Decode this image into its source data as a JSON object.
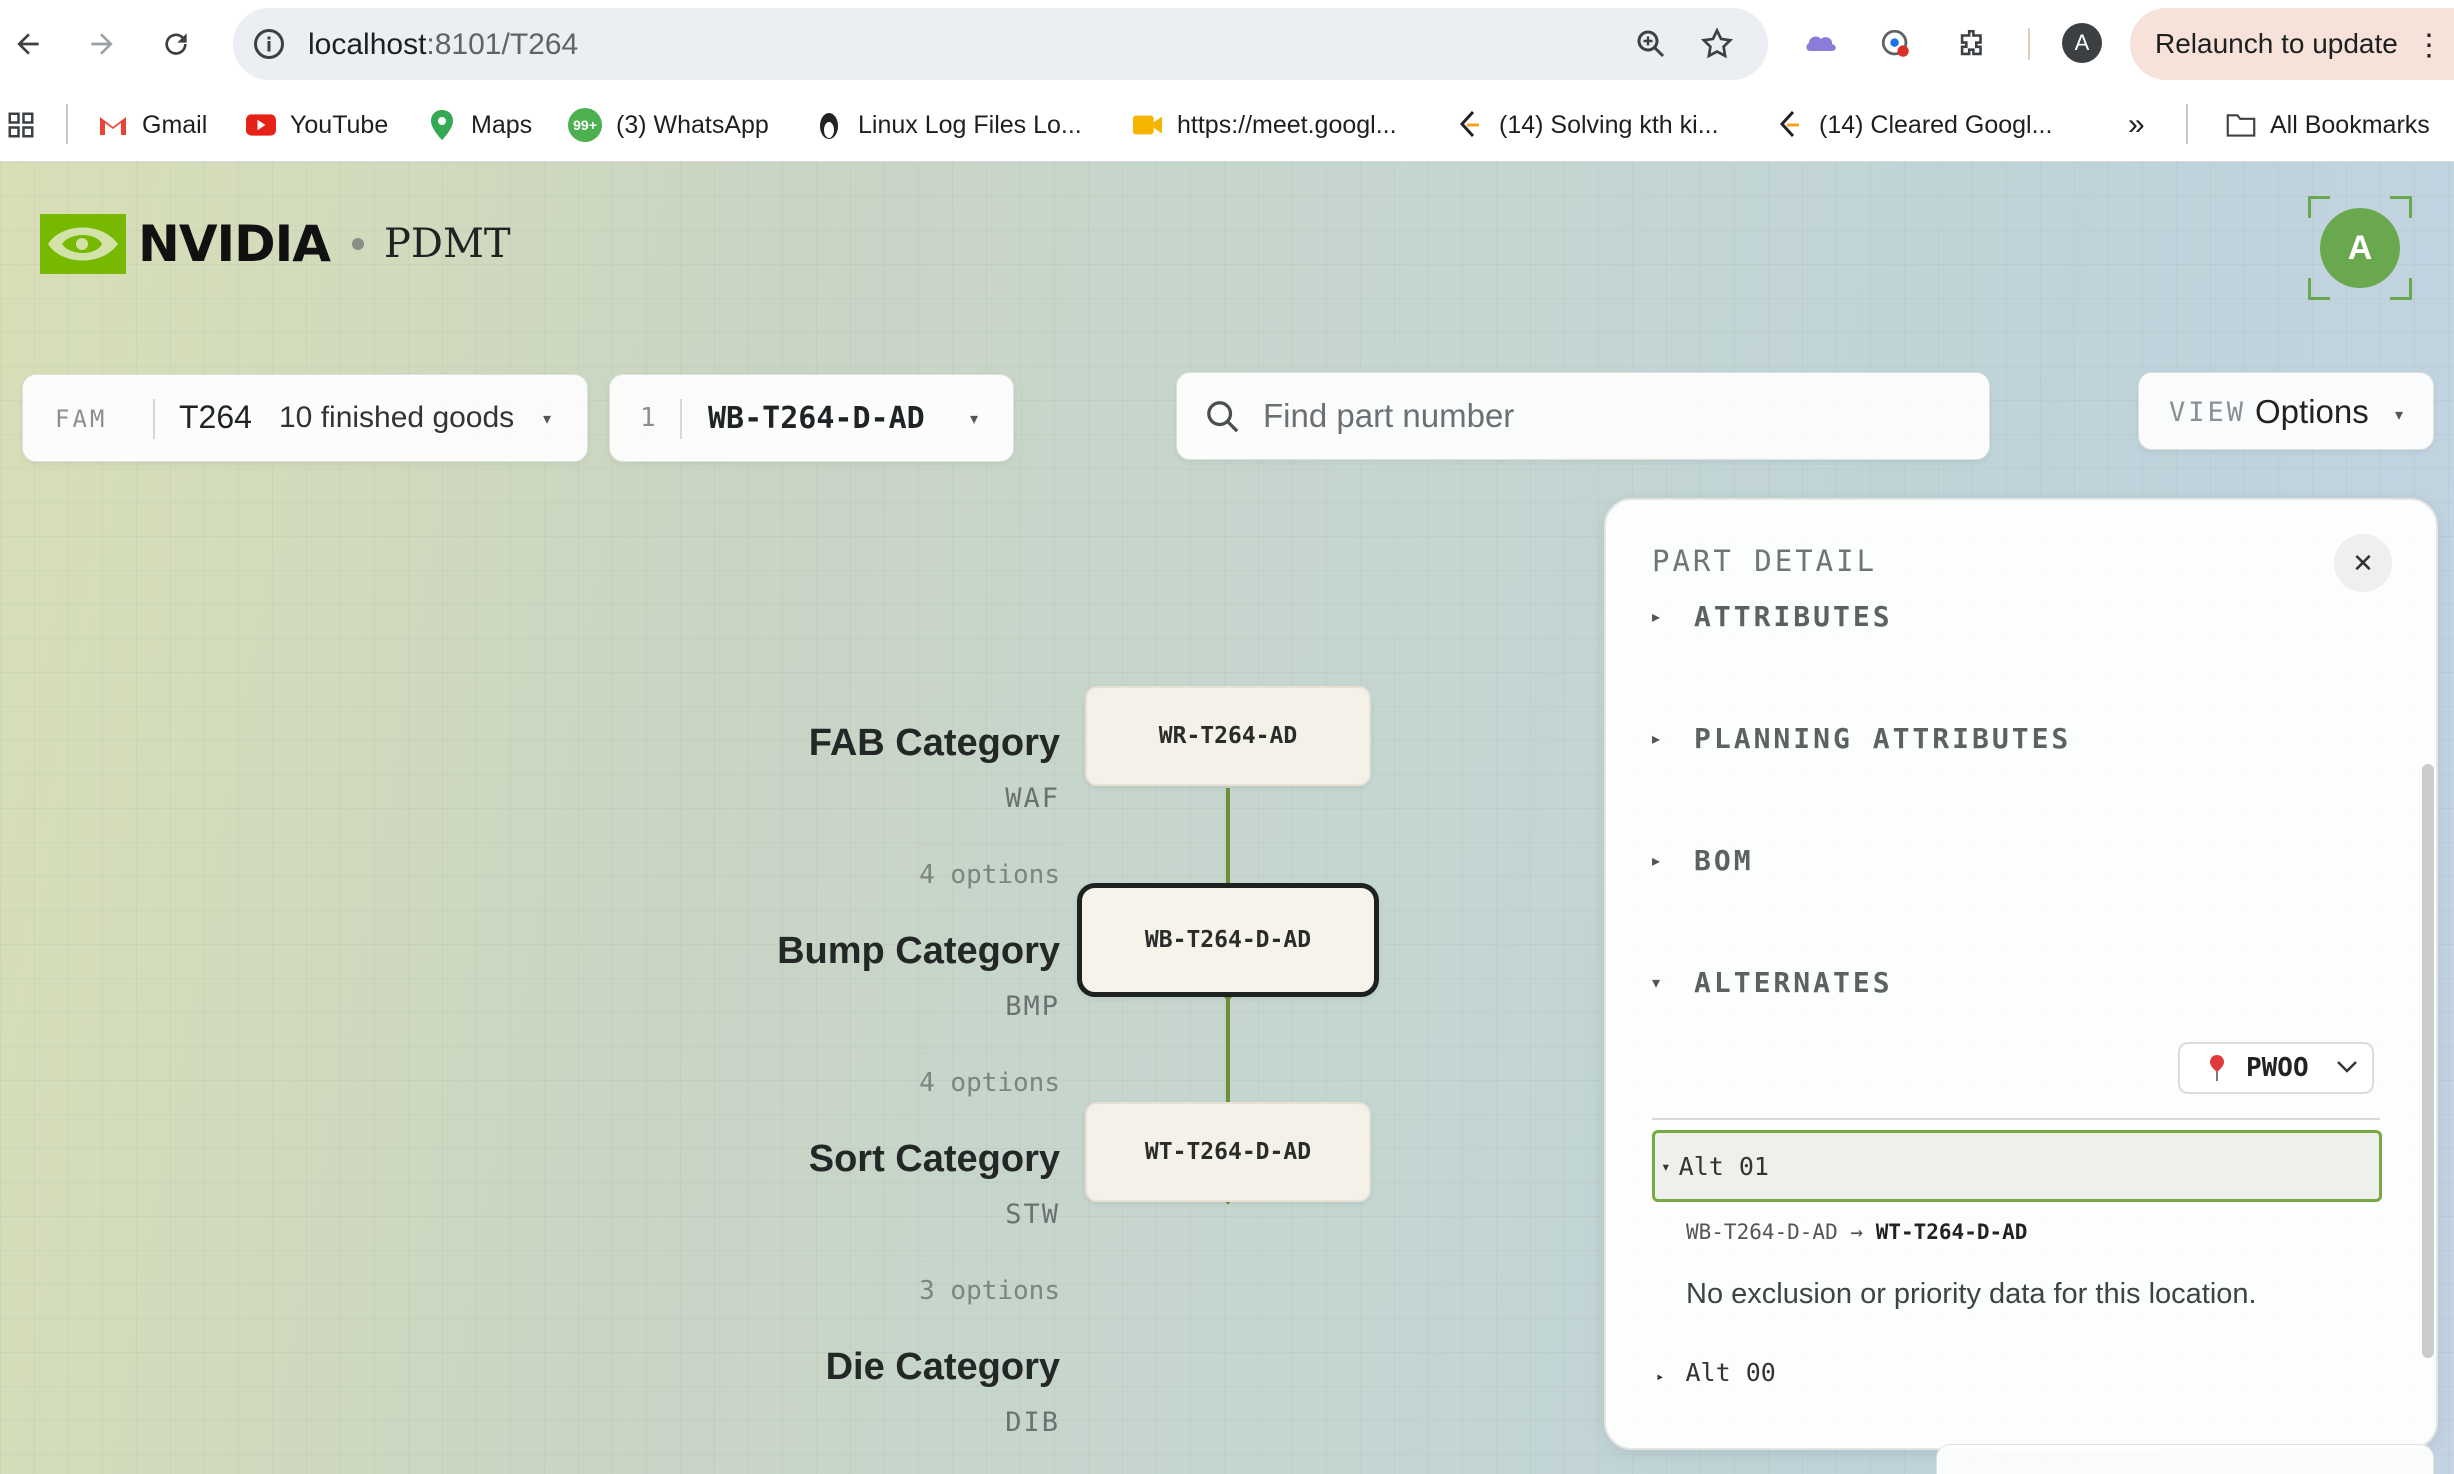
{
  "browser": {
    "url_host": "localhost",
    "url_rest": ":8101/T264",
    "profile_initial": "A",
    "relaunch_label": "Relaunch to update"
  },
  "bookmarks": {
    "items": [
      {
        "label": "Gmail"
      },
      {
        "label": "YouTube"
      },
      {
        "label": "Maps"
      },
      {
        "label": "(3) WhatsApp",
        "badge": "99+"
      },
      {
        "label": "Linux Log Files Lo..."
      },
      {
        "label": "https://meet.googl..."
      },
      {
        "label": "(14) Solving kth ki..."
      },
      {
        "label": "(14) Cleared Googl..."
      }
    ],
    "all_label": "All Bookmarks"
  },
  "app": {
    "brand": "NVIDIA",
    "name": "PDMT",
    "user_initial": "A",
    "family": {
      "label": "FAM",
      "value": "T264",
      "count": "10 finished goods"
    },
    "finished_good": {
      "index": "1",
      "value": "WB-T264-D-AD"
    },
    "search": {
      "placeholder": "Find part number"
    },
    "view": {
      "label": "VIEW",
      "value": "Options"
    }
  },
  "graph": {
    "categories": [
      {
        "name": "FAB Category",
        "code": "WAF"
      },
      {
        "name": "Bump Category",
        "code": "BMP"
      },
      {
        "name": "Sort Category",
        "code": "STW"
      },
      {
        "name": "Die Category",
        "code": "DIB"
      }
    ],
    "options": [
      "4 options",
      "4 options",
      "3 options"
    ],
    "nodes": [
      "WR-T264-AD",
      "WB-T264-D-AD",
      "WT-T264-D-AD"
    ],
    "selected_node": "WB-T264-D-AD",
    "edge_color": "#6b8e3a"
  },
  "panel": {
    "title": "PART DETAIL",
    "close_glyph": "✕",
    "sections": [
      {
        "label": "ATTRIBUTES",
        "expanded": false
      },
      {
        "label": "PLANNING ATTRIBUTES",
        "expanded": false
      },
      {
        "label": "BOM",
        "expanded": false
      },
      {
        "label": "ALTERNATES",
        "expanded": true
      }
    ],
    "location": "PWOO",
    "alternates": [
      {
        "label": "Alt 01",
        "expanded": true,
        "from": "WB-T264-D-AD",
        "arrow": "→",
        "to": "WT-T264-D-AD",
        "note": "No exclusion or priority data for this location."
      },
      {
        "label": "Alt 00",
        "expanded": false
      }
    ],
    "accent": "#78a840"
  }
}
